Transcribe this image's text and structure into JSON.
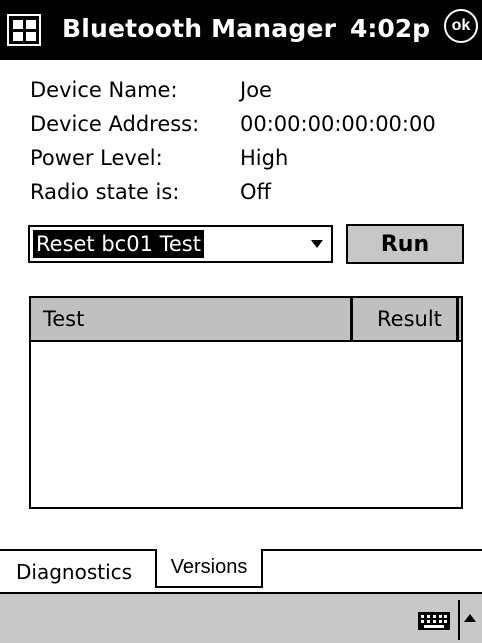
{
  "titlebar": {
    "icon": "windows-flag-icon",
    "title": "Bluetooth Manager",
    "time": "4:02p",
    "ok_label": "ok"
  },
  "info": {
    "device_name_label": "Device Name:",
    "device_name_value": "Joe",
    "device_address_label": "Device Address:",
    "device_address_value": "00:00:00:00:00:00",
    "power_level_label": "Power Level:",
    "power_level_value": "High",
    "radio_state_label": "Radio state is:",
    "radio_state_value": "Off"
  },
  "test_select": {
    "selected": "Reset bc01 Test",
    "icon": "dropdown-arrow-icon"
  },
  "run_button": {
    "label": "Run"
  },
  "results_table": {
    "columns": [
      "Test",
      "Result"
    ],
    "rows": []
  },
  "tabs": [
    {
      "label": "Diagnostics",
      "selected": true
    },
    {
      "label": "Versions",
      "selected": false
    }
  ],
  "bottom_bar": {
    "keyboard_icon": "keyboard-icon",
    "sip_icon": "sip-arrow-up-icon"
  }
}
